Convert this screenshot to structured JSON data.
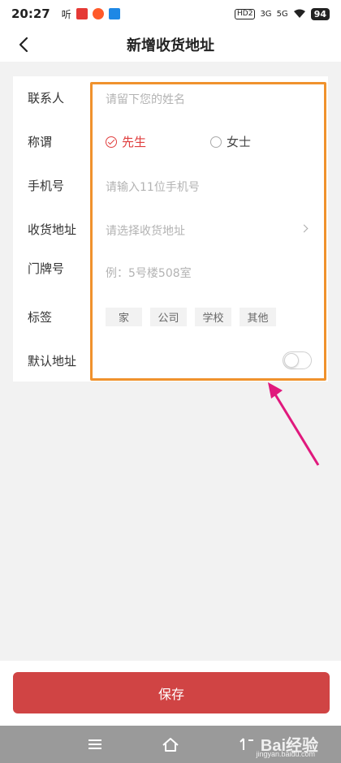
{
  "status_bar": {
    "time": "20:27",
    "app_label": "听",
    "network_1": "HD2",
    "network_2": "3G",
    "network_3": "5G",
    "battery": "94"
  },
  "header": {
    "title": "新增收货地址",
    "back_icon": "chevron-left-icon"
  },
  "form": {
    "contact": {
      "label": "联系人",
      "placeholder": "请留下您的姓名"
    },
    "salutation": {
      "label": "称谓",
      "options": [
        {
          "label": "先生",
          "selected": true
        },
        {
          "label": "女士",
          "selected": false
        }
      ],
      "selected_color": "#e03e3e"
    },
    "phone": {
      "label": "手机号",
      "placeholder": "请输入11位手机号"
    },
    "address": {
      "label": "收货地址",
      "placeholder": "请选择收货地址"
    },
    "door": {
      "label": "门牌号",
      "placeholder": "例：5号楼508室"
    },
    "tags": {
      "label": "标签",
      "items": [
        "家",
        "公司",
        "学校",
        "其他"
      ]
    },
    "default": {
      "label": "默认地址",
      "enabled": false
    }
  },
  "footer": {
    "save_label": "保存",
    "save_color": "#d04444"
  },
  "system_nav": {
    "icons": [
      "menu-icon",
      "home-icon",
      "back-icon"
    ]
  },
  "overlay": {
    "highlight_color": "#f0922d",
    "arrow_color": "#e0197d",
    "watermark": "Bai经验",
    "watermark_sub": "jingyan.baidu.com"
  }
}
